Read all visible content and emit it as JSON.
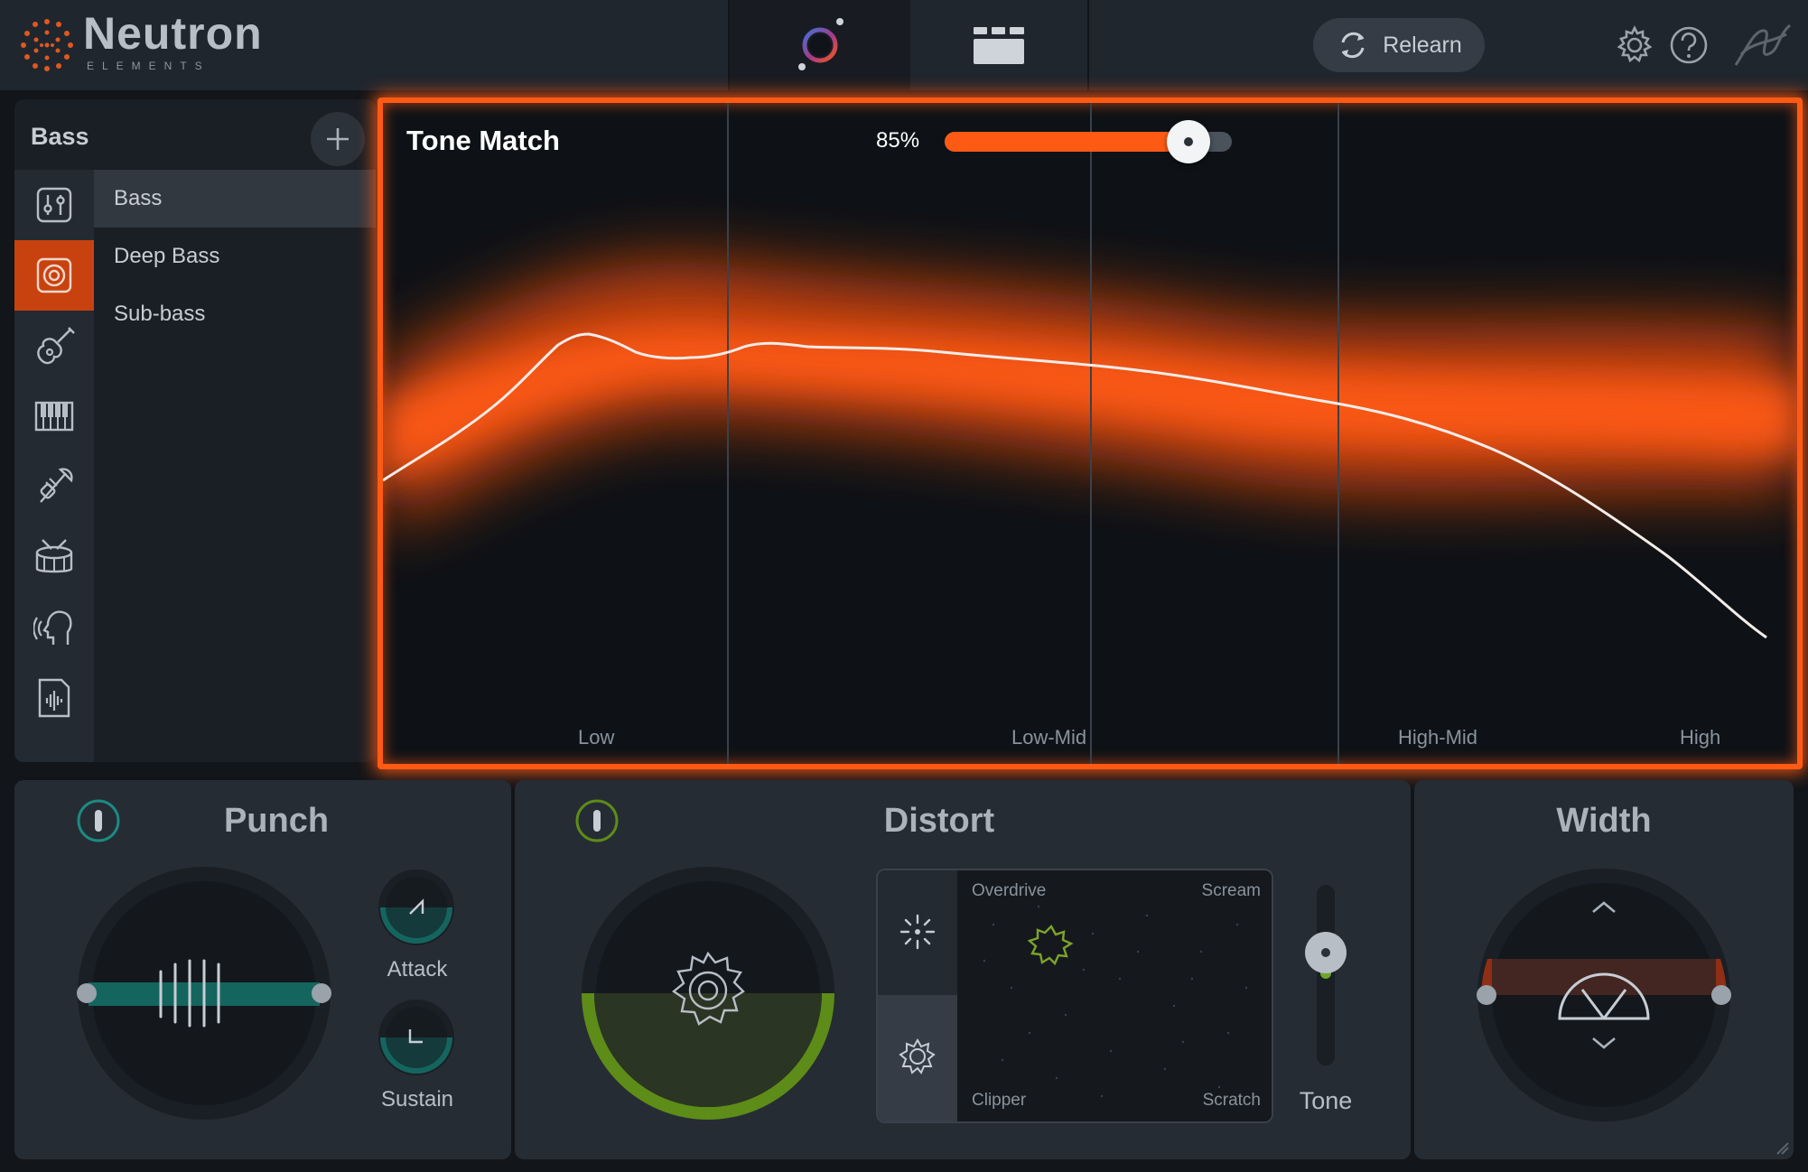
{
  "header": {
    "logo_title": "Neutron",
    "logo_subtitle": "ELEMENTS",
    "nav_tabs": [
      {
        "name": "assistant",
        "icon": "assistant-orb-icon",
        "active": true
      },
      {
        "name": "modules",
        "icon": "modules-grid-icon",
        "active": false
      }
    ],
    "relearn_label": "Relearn",
    "icons": [
      "gear-icon",
      "help-icon",
      "logo-squiggle-icon"
    ]
  },
  "sidebar": {
    "title": "Bass",
    "categories": [
      {
        "icon": "mixer-sliders-icon",
        "active": false
      },
      {
        "icon": "speaker-icon",
        "active": true
      },
      {
        "icon": "guitar-icon",
        "active": false
      },
      {
        "icon": "piano-keys-icon",
        "active": false
      },
      {
        "icon": "trumpet-icon",
        "active": false
      },
      {
        "icon": "drum-icon",
        "active": false
      },
      {
        "icon": "voice-head-icon",
        "active": false
      },
      {
        "icon": "audio-file-icon",
        "active": false
      }
    ],
    "items": [
      {
        "label": "Bass",
        "active": true
      },
      {
        "label": "Deep Bass",
        "active": false
      },
      {
        "label": "Sub-bass",
        "active": false
      }
    ]
  },
  "tone_match": {
    "title": "Tone Match",
    "amount_label": "85%",
    "amount": 0.85,
    "bands": [
      "Low",
      "Low-Mid",
      "High-Mid",
      "High"
    ],
    "accent_color": "#ff5a14"
  },
  "punch": {
    "title": "Punch",
    "attack_label": "Attack",
    "sustain_label": "Sustain",
    "accent_color": "#15655f"
  },
  "distort": {
    "title": "Distort",
    "grid_labels": {
      "top_left": "Overdrive",
      "top_right": "Scream",
      "bottom_left": "Clipper",
      "bottom_right": "Scratch"
    },
    "tone_label": "Tone",
    "accent_color": "#5d8c19"
  },
  "width": {
    "title": "Width",
    "accent_color": "#8f2f16"
  }
}
